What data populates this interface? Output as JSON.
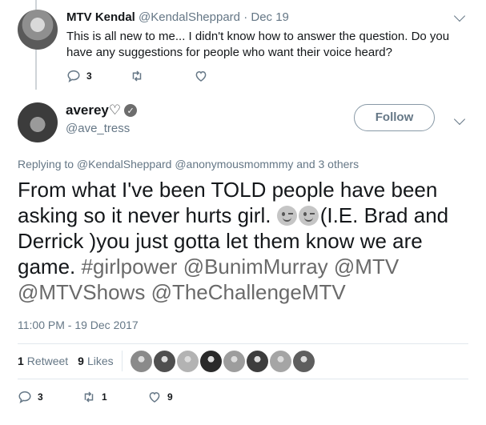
{
  "parent_tweet": {
    "display_name": "MTV Kendal",
    "handle": "@KendalSheppard",
    "date_sep": "·",
    "date": "Dec 19",
    "text": "This is all new to me... I didn't know how to answer the question. Do you have any suggestions for people who want their voice heard?",
    "reply_count": "3",
    "retweet_count": "",
    "like_count": ""
  },
  "main_tweet": {
    "display_name": "averey♡",
    "handle": "@ave_tress",
    "follow_label": "Follow",
    "replying_to": "Replying to @KendalSheppard @anonymousmommmy and 3 others",
    "text_parts": {
      "intro": "From what I've been TOLD people have been asking so it never hurts girl.",
      "after_emoji": "(I.E. Brad and Derrick )you just gotta let them know we are game.",
      "hashtag": "#girlpower",
      "mention1": "@BunimMurray",
      "mention2": "@MTV",
      "mention3": "@MTVShows",
      "mention4": "@TheChallengeMTV"
    },
    "timestamp": "11:00 PM - 19 Dec 2017",
    "retweets_num": "1",
    "retweets_label": "Retweet",
    "likes_num": "9",
    "likes_label": "Likes",
    "reply_count": "3",
    "retweet_count": "1",
    "like_count": "9",
    "liker_tones": [
      "#8a8a8a",
      "#4f4f4f",
      "#b3b3b3",
      "#2a2a2a",
      "#9d9d9d",
      "#3d3d3d",
      "#a5a5a5",
      "#5e5e5e"
    ]
  },
  "icons": [
    "reply-icon",
    "retweet-icon",
    "like-icon",
    "verified-icon",
    "caret-down-icon",
    "wink-emoji-icon"
  ],
  "colors": {
    "text": "#14171a",
    "secondary": "#657786",
    "divider": "#e1e8ed",
    "thread": "#cfd4d8"
  }
}
